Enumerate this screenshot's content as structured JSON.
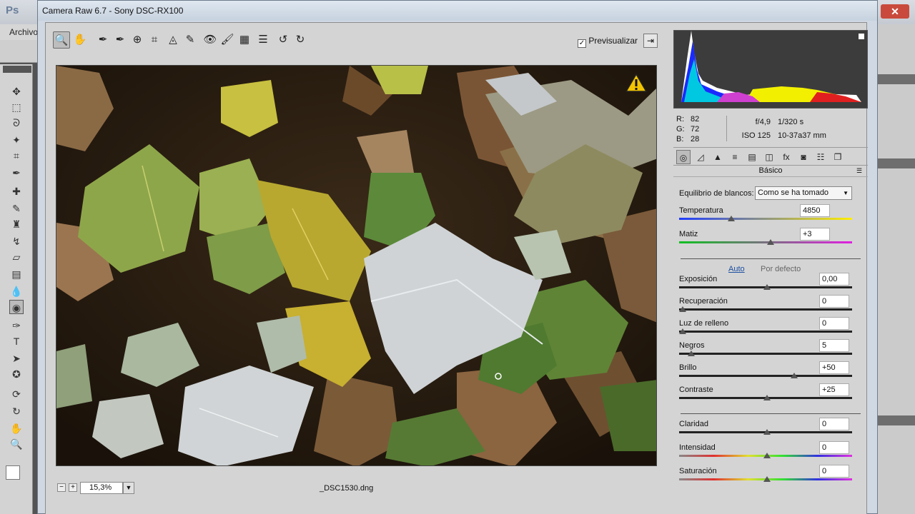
{
  "photoshop": {
    "logo": "Ps",
    "menu_first": "Archivo"
  },
  "dialog": {
    "title": "Camera Raw 6.7  -  Sony DSC-RX100"
  },
  "toolbar": {
    "tools": [
      {
        "name": "zoom-tool",
        "glyph": "🔍"
      },
      {
        "name": "hand-tool",
        "glyph": "✋"
      },
      {
        "name": "white-balance-tool",
        "glyph": "✒"
      },
      {
        "name": "color-sampler-tool",
        "glyph": "✒"
      },
      {
        "name": "targeted-adjustment-tool",
        "glyph": "⊕"
      },
      {
        "name": "crop-tool",
        "glyph": "⌗"
      },
      {
        "name": "straighten-tool",
        "glyph": "◬"
      },
      {
        "name": "spot-removal-tool",
        "glyph": "✎"
      },
      {
        "name": "red-eye-tool",
        "glyph": "👁"
      },
      {
        "name": "adjustment-brush-tool",
        "glyph": "🖌"
      },
      {
        "name": "graduated-filter-tool",
        "glyph": "▦"
      },
      {
        "name": "preferences-tool",
        "glyph": "☰"
      },
      {
        "name": "rotate-ccw-tool",
        "glyph": "↺"
      },
      {
        "name": "rotate-cw-tool",
        "glyph": "↻"
      }
    ],
    "preview_label": "Previsualizar",
    "preview_checked": true
  },
  "bottom": {
    "zoom_value": "15,3%",
    "filename": "_DSC1530.dng"
  },
  "readout": {
    "r_label": "R:",
    "r": "82",
    "g_label": "G:",
    "g": "72",
    "b_label": "B:",
    "b": "28"
  },
  "exif": {
    "aperture": "f/4,9",
    "shutter": "1/320 s",
    "iso": "ISO 125",
    "lens": "10-37a37 mm"
  },
  "panel": {
    "title": "Básico",
    "wb_label": "Equilibrio de blancos:",
    "wb_value": "Como se ha tomado",
    "auto_label": "Auto",
    "default_label": "Por defecto",
    "sliders": [
      {
        "key": "temperatura",
        "label": "Temperatura",
        "value": "4850",
        "pos": 0.29
      },
      {
        "key": "matiz",
        "label": "Matiz",
        "value": "+3",
        "pos": 0.52
      },
      {
        "key": "exposicion",
        "label": "Exposición",
        "value": "0,00",
        "pos": 0.5
      },
      {
        "key": "recuperacion",
        "label": "Recuperación",
        "value": "0",
        "pos": 0.0
      },
      {
        "key": "luz-relleno",
        "label": "Luz de relleno",
        "value": "0",
        "pos": 0.0
      },
      {
        "key": "negros",
        "label": "Negros",
        "value": "5",
        "pos": 0.05
      },
      {
        "key": "brillo",
        "label": "Brillo",
        "value": "+50",
        "pos": 0.66
      },
      {
        "key": "contraste",
        "label": "Contraste",
        "value": "+25",
        "pos": 0.5
      },
      {
        "key": "claridad",
        "label": "Claridad",
        "value": "0",
        "pos": 0.5
      },
      {
        "key": "intensidad",
        "label": "Intensidad",
        "value": "0",
        "pos": 0.5
      },
      {
        "key": "saturacion",
        "label": "Saturación",
        "value": "0",
        "pos": 0.5
      }
    ]
  },
  "colors": {
    "accent_link": "#1c4fa0",
    "warning": "#f2c400"
  }
}
